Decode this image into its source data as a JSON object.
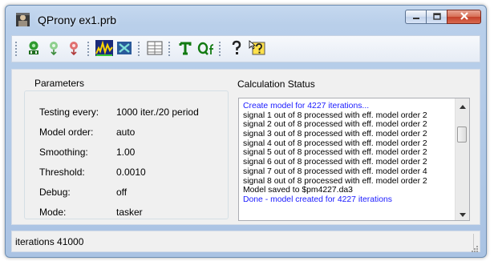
{
  "window": {
    "title": "QProny ex1.prb",
    "controls": [
      "minimize-icon",
      "maximize-icon",
      "close-icon"
    ]
  },
  "toolbar": {
    "buttons": [
      "run-model-icon",
      "load-icon",
      "unload-icon",
      "spectrum-icon",
      "clear-icon",
      "table-icon",
      "text-icon",
      "qf-icon",
      "help-icon",
      "context-help-icon"
    ]
  },
  "parameters": {
    "heading": "Parameters",
    "rows": [
      {
        "label": "Testing every:",
        "value": "1000 iter./20 period"
      },
      {
        "label": "Model order:",
        "value": "auto"
      },
      {
        "label": "Smoothing:",
        "value": "1.00"
      },
      {
        "label": "Threshold:",
        "value": "0.0010"
      },
      {
        "label": "Debug:",
        "value": "off"
      },
      {
        "label": "Mode:",
        "value": "tasker"
      }
    ]
  },
  "calculation_status": {
    "heading": "Calculation Status",
    "lines": [
      {
        "text": "Create model for 4227 iterations...",
        "color": "#1a1aff"
      },
      {
        "text": "signal 1 out of 8 processed with eff. model order 2",
        "color": "#000000"
      },
      {
        "text": "signal 2 out of 8 processed with eff. model order 2",
        "color": "#000000"
      },
      {
        "text": "signal 3 out of 8 processed with eff. model order 2",
        "color": "#000000"
      },
      {
        "text": "signal 4 out of 8 processed with eff. model order 2",
        "color": "#000000"
      },
      {
        "text": "signal 5 out of 8 processed with eff. model order 2",
        "color": "#000000"
      },
      {
        "text": "signal 6 out of 8 processed with eff. model order 2",
        "color": "#000000"
      },
      {
        "text": "signal 7 out of 8 processed with eff. model order 4",
        "color": "#000000"
      },
      {
        "text": "signal 8 out of 8 processed with eff. model order 2",
        "color": "#000000"
      },
      {
        "text": "Model saved to $pm4227.da3",
        "color": "#000000"
      },
      {
        "text": "Done - model created for 4227 iterations",
        "color": "#1a1aff"
      }
    ]
  },
  "statusbar": {
    "text": "iterations 41000"
  }
}
